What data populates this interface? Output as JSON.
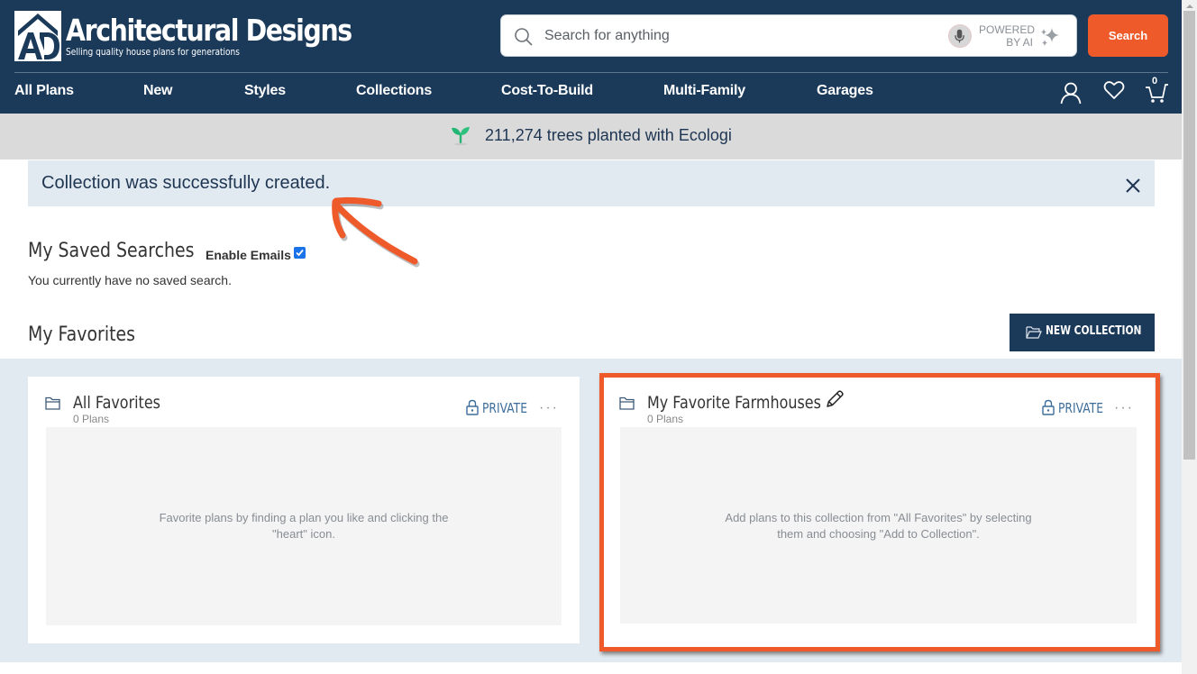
{
  "header": {
    "brand": {
      "logo_mark": "AD",
      "title": "Architectural Designs",
      "tagline": "Selling quality house plans for generations"
    },
    "search": {
      "placeholder": "Search for anything",
      "value": "",
      "powered_line1": "POWERED",
      "powered_line2": "BY AI",
      "button_label": "Search"
    },
    "nav": [
      {
        "label": "All Plans"
      },
      {
        "label": "New"
      },
      {
        "label": "Styles"
      },
      {
        "label": "Collections"
      },
      {
        "label": "Cost-To-Build"
      },
      {
        "label": "Multi-Family"
      },
      {
        "label": "Garages"
      }
    ],
    "icons": {
      "account": "user-icon",
      "favorites": "heart-icon",
      "cart": "cart-icon"
    },
    "cart_count": "0"
  },
  "ecologi": {
    "text": "211,274 trees planted with Ecologi",
    "icon": "sprout-icon"
  },
  "alert": {
    "message": "Collection was successfully created."
  },
  "saved_searches": {
    "title": "My Saved Searches",
    "enable_emails_label": "Enable Emails",
    "enable_emails_checked": true,
    "empty_text": "You currently have no saved search."
  },
  "favorites": {
    "title": "My Favorites",
    "new_collection_label": "NEW COLLECTION",
    "collections": [
      {
        "name": "All Favorites",
        "count": "0 Plans",
        "privacy": "PRIVATE",
        "more": "···",
        "editable": false,
        "empty_text_line1": "Favorite plans by finding a plan you like and clicking the",
        "empty_text_line2": "\"heart\" icon."
      },
      {
        "name": "My Favorite Farmhouses",
        "count": "0 Plans",
        "privacy": "PRIVATE",
        "more": "···",
        "editable": true,
        "highlighted": true,
        "empty_text_line1": "Add plans to this collection from \"All Favorites\" by selecting",
        "empty_text_line2": "them and choosing \"Add to Collection\"."
      }
    ]
  },
  "colors": {
    "brand_navy": "#1b3a5a",
    "accent_orange": "#ef5a2a",
    "alert_bg": "#e2eaf1",
    "eco_band": "#dadada",
    "link_blue": "#3d6d9a"
  }
}
